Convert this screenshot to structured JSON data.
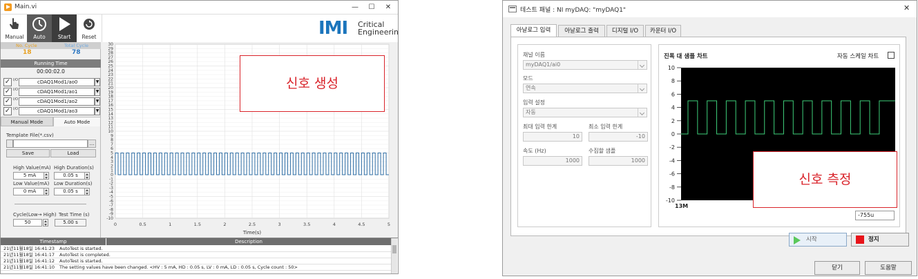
{
  "left": {
    "title": "Main.vi",
    "win_controls": [
      "—",
      "☐",
      "✕"
    ],
    "toolbar": [
      {
        "label": "Manual",
        "icon": "hand-pointer-icon"
      },
      {
        "label": "Auto",
        "icon": "cycle-auto-icon"
      },
      {
        "label": "Start",
        "icon": "play-icon"
      },
      {
        "label": "Reset",
        "icon": "reset-icon"
      }
    ],
    "logo": {
      "mark": "IMI",
      "line1": "Critical",
      "line2": "Engineering",
      "color": "#1b75bc"
    },
    "counters": {
      "no_cycle_label": "No. Cycle",
      "total_cycle_label": "Total Cycle",
      "no_cycle": "18",
      "total_cycle": "78"
    },
    "running_time_label": "Running Time",
    "running_time": "00:00:02.0",
    "channels": [
      {
        "name": "cDAQ1Mod1/ao0",
        "checked": true
      },
      {
        "name": "cDAQ1Mod1/ao1",
        "checked": true
      },
      {
        "name": "cDAQ1Mod1/ao2",
        "checked": true
      },
      {
        "name": "cDAQ1Mod1/ao3",
        "checked": true
      }
    ],
    "io_badge": "I/O",
    "tabs": [
      "Manual Mode",
      "Auto Mode"
    ],
    "template_label": "Template File(*.csv)",
    "template_value": "",
    "browse_label": "...",
    "save_label": "Save",
    "load_label": "Load",
    "high_value_label": "High Value(mA)",
    "high_value": "5 mA",
    "high_duration_label": "High Duration(s)",
    "high_duration": "0.05 s",
    "low_value_label": "Low Value(mA)",
    "low_value": "0 mA",
    "low_duration_label": "Low Duration(s)",
    "low_duration": "0.05 s",
    "cycle_label": "Cycle(Low→ High)",
    "cycle_value": "50",
    "test_time_label": "Test Time (s)",
    "test_time": "5.00 s",
    "log": {
      "headers": [
        "Timestamp",
        "Description"
      ],
      "rows": [
        {
          "time": "21년11월18일 16:41:23",
          "desc": "AutoTest is started."
        },
        {
          "time": "21년11월18일 16:41:17",
          "desc": "AutoTest is completed."
        },
        {
          "time": "21년11월18일 16:41:12",
          "desc": "AutoTest is started."
        },
        {
          "time": "21년11월18일 16:41:10",
          "desc": "The setting values have been changed. <HV : 5 mA, HD : 0.05 s, LV : 0 mA, LD : 0.05 s, Cycle count : 50>"
        }
      ]
    },
    "annotation": "신호 생성",
    "accent_color": "#1b75bc"
  },
  "right": {
    "title": "테스트 패널 : NI myDAQ: \"myDAQ1\"",
    "close_label": "✕",
    "tabs": [
      "아날로그 입력",
      "아날로그 출력",
      "디지털 I/O",
      "카운터 I/O"
    ],
    "channel_name_label": "채널 이름",
    "channel_name": "myDAQ1/ai0",
    "mode_label": "모드",
    "mode": "연속",
    "input_config_label": "입력 설정",
    "input_config": "자동",
    "max_input_label": "최대 입력 한계",
    "max_input": "10",
    "min_input_label": "최소 입력 한계",
    "min_input": "-10",
    "rate_label": "속도 (Hz)",
    "rate": "1000",
    "samples_label": "수집할 샘플",
    "samples": "1000",
    "chart_label": "진폭 대 샘플 차트",
    "autoscale_label": "자동 스케일 차트",
    "readout": "-755u",
    "start_label": "시작",
    "stop_label": "정지",
    "close_btn_label": "닫기",
    "help_label": "도움말",
    "annotation": "신호 측정"
  },
  "chart_data": [
    {
      "type": "line",
      "title": "",
      "xlabel": "Time(s)",
      "ylabel": "",
      "xlim": [
        0,
        5
      ],
      "ylim": [
        -10,
        30
      ],
      "x_ticks": [
        "0",
        "0.5",
        "1",
        "1.5",
        "2",
        "2.5",
        "3",
        "3.5",
        "4",
        "4.5",
        "5"
      ],
      "y_ticks": [
        "30",
        "29",
        "28",
        "27",
        "26",
        "25",
        "24",
        "23",
        "22",
        "21",
        "20",
        "19",
        "18",
        "17",
        "16",
        "15",
        "14",
        "13",
        "12",
        "11",
        "10",
        "9",
        "8",
        "7",
        "6",
        "5",
        "4",
        "3",
        "2",
        "1",
        "0",
        "-1",
        "-2",
        "-3",
        "-4",
        "-5",
        "-6",
        "-7",
        "-8",
        "-9",
        "-10"
      ],
      "series": [
        {
          "high": 5,
          "low": 0,
          "high_duration": 0.05,
          "low_duration": 0.05,
          "cycles": 50,
          "color": "#2e6da4"
        }
      ],
      "grid": true
    },
    {
      "type": "line",
      "title": "진폭 대 샘플 차트",
      "xlabel": "",
      "ylabel": "",
      "ylim": [
        -10,
        10
      ],
      "y_ticks": [
        "10",
        "8",
        "6",
        "4",
        "2",
        "0",
        "-2",
        "-4",
        "-6",
        "-8",
        "-10"
      ],
      "x_tick_label": "13M",
      "series": [
        {
          "high": 5,
          "low": 0,
          "periods_visible": 10,
          "color": "#3ecf7a"
        }
      ],
      "grid": false
    }
  ]
}
